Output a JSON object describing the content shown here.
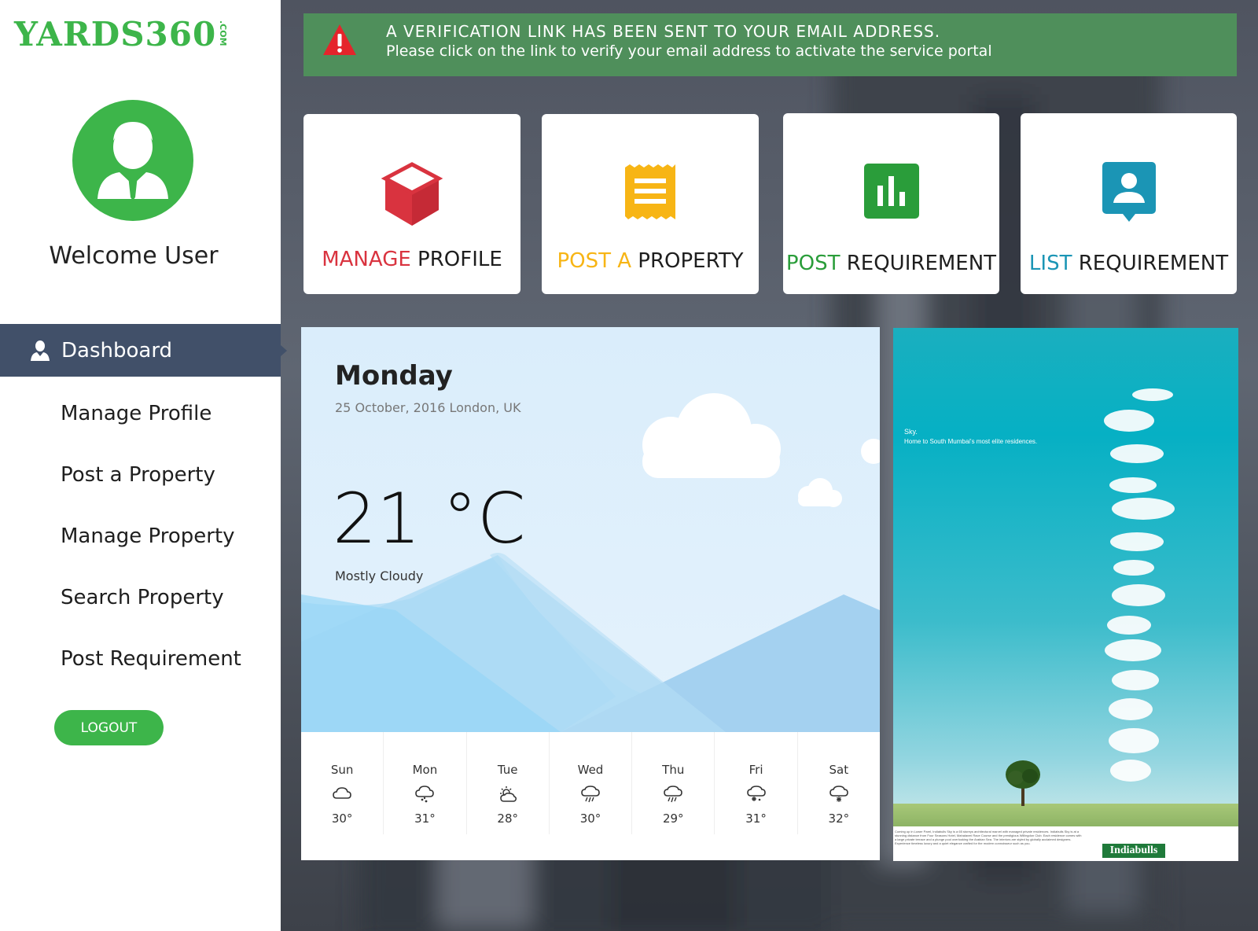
{
  "brand": {
    "logo_text": "YARDS360",
    "logo_suffix": ".COM",
    "accent": "#3db54a"
  },
  "sidebar": {
    "welcome": "Welcome User",
    "items": [
      {
        "label": "Dashboard",
        "active": true,
        "icon": "user-icon"
      },
      {
        "label": "Manage Profile"
      },
      {
        "label": "Post a Property"
      },
      {
        "label": "Manage Property"
      },
      {
        "label": "Search Property"
      },
      {
        "label": "Post Requirement"
      }
    ],
    "logout_label": "LOGOUT"
  },
  "alert": {
    "title": "A VERIFICATION LINK HAS BEEN SENT TO YOUR EMAIL ADDRESS.",
    "message": "Please click on the link to verify your email address to activate the service portal",
    "icon": "warning-icon"
  },
  "tiles": [
    {
      "highlight": "MANAGE",
      "rest": " PROFILE",
      "color": "#d9333f",
      "icon": "cube-icon"
    },
    {
      "highlight": "POST A",
      "rest": " PROPERTY",
      "color": "#f7b515",
      "icon": "receipt-icon"
    },
    {
      "highlight": "POST",
      "rest": " REQUIREMENT",
      "color": "#2a9d3a",
      "icon": "bar-chart-icon"
    },
    {
      "highlight": "LIST",
      "rest": " REQUIREMENT",
      "color": "#1b95b5",
      "icon": "contact-icon"
    }
  ],
  "weather": {
    "day": "Monday",
    "date": "25 October, 2016 London, UK",
    "temp": "21 °C",
    "condition": "Mostly Cloudy",
    "forecast": [
      {
        "day": "Sun",
        "temp": "30°",
        "icon": "cloud-icon"
      },
      {
        "day": "Mon",
        "temp": "31°",
        "icon": "cloud-hail-icon"
      },
      {
        "day": "Tue",
        "temp": "28°",
        "icon": "partly-sunny-icon"
      },
      {
        "day": "Wed",
        "temp": "30°",
        "icon": "cloud-rain-icon"
      },
      {
        "day": "Thu",
        "temp": "29°",
        "icon": "cloud-rain-icon"
      },
      {
        "day": "Fri",
        "temp": "31°",
        "icon": "cloud-snow-icon"
      },
      {
        "day": "Sat",
        "temp": "32°",
        "icon": "cloud-snow-icon"
      }
    ]
  },
  "ad": {
    "line1": "Sky.",
    "line2": "Home to South Mumbai's most elite residences.",
    "footer": "Coming up in Lower Parel, Indiabulls Sky is a 65 storeys architectural marvel with managed private residences. Indiabulls Sky is at a stunning distance from Four Seasons Hotel, Mahalaxmi Race Course and the prestigious Willingdon Club. Each residence comes with a large private terrace and a plunge pool overlooking the Arabian Sea. The interiors are styled by globally acclaimed designers. Experience timeless luxury and a quiet elegance crafted for the modern connoisseur such as you.",
    "brand": "Indiabulls"
  }
}
